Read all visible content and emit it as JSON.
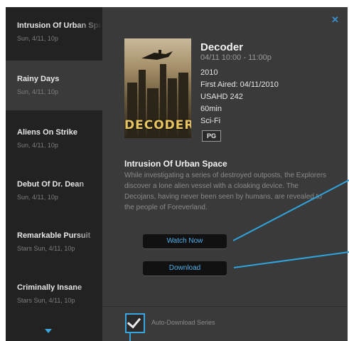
{
  "episodes": [
    {
      "title": "Intrusion Of Urban Space",
      "subtitle": "Sun, 4/11, 10p"
    },
    {
      "title": "Rainy Days",
      "subtitle": "Sun, 4/11, 10p"
    },
    {
      "title": "Aliens On Strike",
      "subtitle": "Sun, 4/11, 10p"
    },
    {
      "title": "Debut Of Dr. Dean",
      "subtitle": "Sun, 4/11, 10p"
    },
    {
      "title": "Remarkable Pursuit",
      "subtitle": "Stars Sun, 4/11, 10p"
    },
    {
      "title": "Criminally Insane",
      "subtitle": "Stars Sun, 4/11, 10p"
    }
  ],
  "detail": {
    "close_icon": "close-icon",
    "show_title": "Decoder",
    "time": "04/11  10:00 - 11:00p",
    "year": "2010",
    "first_aired": "First Aired: 04/11/2010",
    "channel": "USAHD 242",
    "duration": "60min",
    "genre": "Sci-Fi",
    "rating": "PG",
    "poster_text": "DECODER",
    "episode_title": "Intrusion Of Urban Space",
    "description": "While investigating a series of destroyed outposts, the Explorers discover a lone alien vessel with a cloaking device. The Decojans, having never been seen by humans, are revealed to the people of Foreverland."
  },
  "buttons": {
    "watch_now": "Watch Now",
    "download": "Download"
  },
  "auto_download": {
    "label": "Auto-Download Series",
    "checked": true
  },
  "colors": {
    "accent": "#3aa6e0",
    "panel": "#3a3a3a",
    "sidebar": "#222222"
  }
}
